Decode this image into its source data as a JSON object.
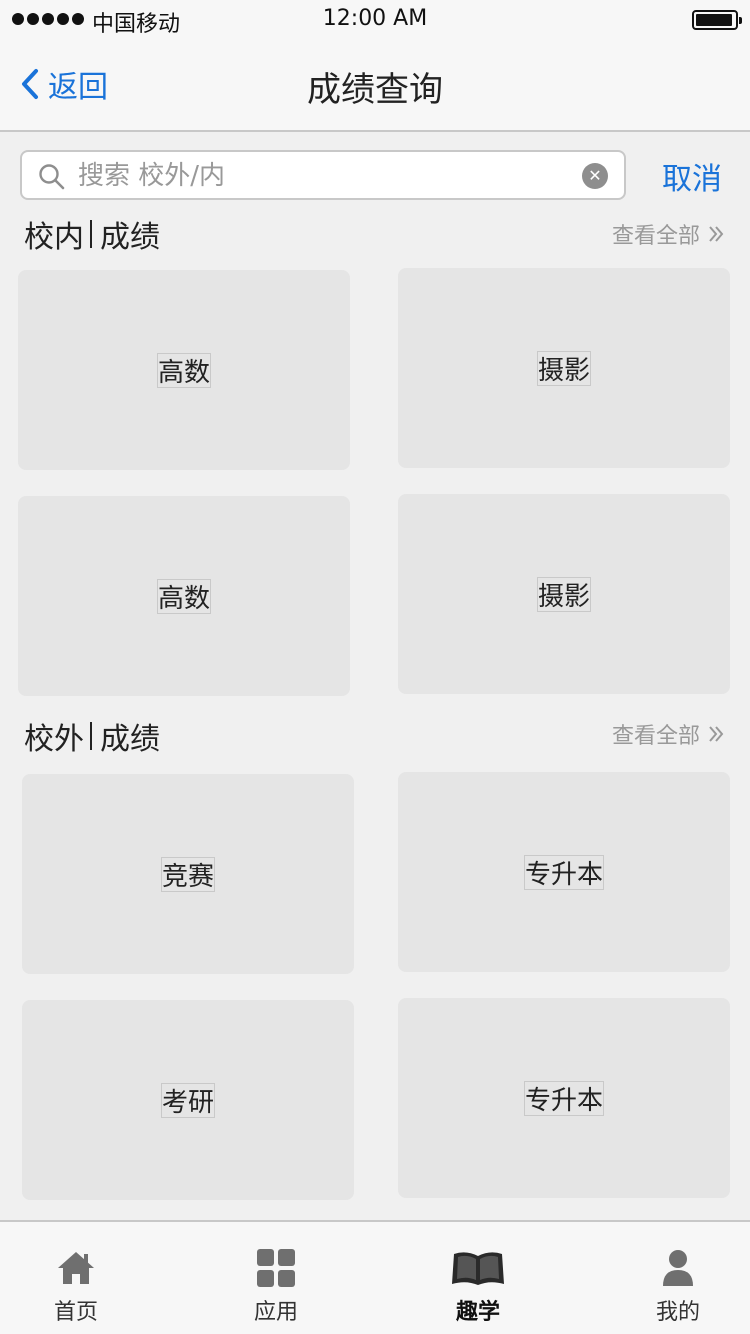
{
  "status_bar": {
    "carrier": "中国移动",
    "time": "12:00 AM"
  },
  "nav": {
    "back_label": "返回",
    "title": "成绩查询"
  },
  "search": {
    "placeholder": "搜索 校外/内",
    "value": "",
    "cancel_label": "取消"
  },
  "sections": [
    {
      "title_a": "校内",
      "title_b": "成绩",
      "view_all": "查看全部",
      "cards": [
        {
          "label": "高数"
        },
        {
          "label": "摄影"
        },
        {
          "label": "高数"
        },
        {
          "label": "摄影"
        }
      ]
    },
    {
      "title_a": "校外",
      "title_b": "成绩",
      "view_all": "查看全部",
      "cards": [
        {
          "label": "竞赛"
        },
        {
          "label": "专升本"
        },
        {
          "label": "考研"
        },
        {
          "label": "专升本"
        }
      ]
    }
  ],
  "tab_bar": {
    "items": [
      {
        "label": "首页",
        "icon": "home-icon"
      },
      {
        "label": "应用",
        "icon": "grid-icon"
      },
      {
        "label": "趣学",
        "icon": "book-icon",
        "active": true
      },
      {
        "label": "我的",
        "icon": "user-icon"
      }
    ]
  },
  "colors": {
    "accent": "#1a73d9",
    "background": "#f0f0f0",
    "card": "#e5e5e5",
    "muted_text": "#999999"
  }
}
